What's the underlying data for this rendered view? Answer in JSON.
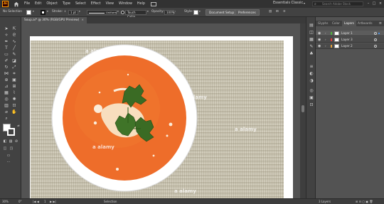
{
  "app": {
    "logo_text": "Ai",
    "menu": [
      "File",
      "Edit",
      "Object",
      "Type",
      "Select",
      "Effect",
      "View",
      "Window",
      "Help"
    ],
    "workspace": "Essentials Classic",
    "search_placeholder": "Search Adobe Stock"
  },
  "control_bar": {
    "selection_label": "No Selection",
    "stroke_label": "Stroke:",
    "stroke_weight": "1 pt",
    "stroke_profile": "Uniform",
    "brush": "Touch Callig...",
    "opacity_label": "Opacity:",
    "opacity_value": "100%",
    "style_label": "Style:",
    "document_setup": "Document Setup",
    "preferences": "Preferences"
  },
  "document": {
    "tab_title": "Soup.ai* @ 30% (RGB/GPU Preview)",
    "close_glyph": "×",
    "watermark": "a alamy"
  },
  "panel": {
    "tabs": [
      "Glyphs",
      "Color",
      "Layers",
      "Artboards"
    ],
    "active_tab": "Layers",
    "layers": [
      {
        "name": "Layer 1",
        "color": "#4fb13c"
      },
      {
        "name": "Layer 3",
        "color": "#e03c3c"
      },
      {
        "name": "Layer 2",
        "color": "#e0a03c"
      }
    ],
    "layer_count": "3 Layers"
  },
  "status_bar": {
    "zoom": "30%",
    "angle": "0°",
    "artboard": "1",
    "tool": "Selection"
  },
  "colors": {
    "accent": "#ff9a00",
    "soup": "#ee6d2a",
    "bowl_rim": "#ffffff",
    "parsley": "#3a6b24"
  }
}
